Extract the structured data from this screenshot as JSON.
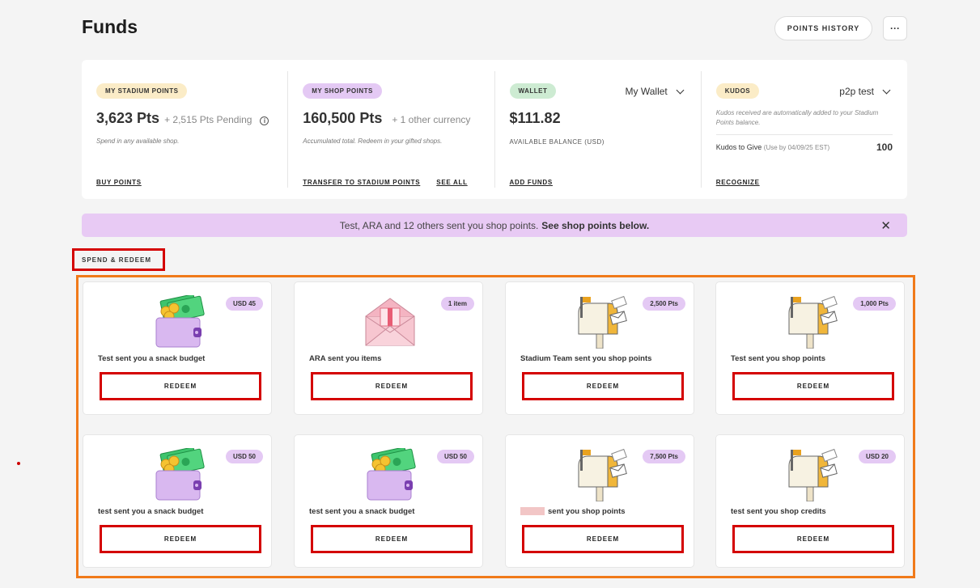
{
  "header": {
    "title": "Funds",
    "points_history_label": "POINTS HISTORY",
    "more_label": "···"
  },
  "funds": {
    "stadium": {
      "chip": "MY STADIUM POINTS",
      "value": "3,623 Pts",
      "pending": "+ 2,515 Pts Pending",
      "desc": "Spend in any available shop.",
      "link": "BUY POINTS"
    },
    "shop": {
      "chip": "MY SHOP POINTS",
      "value": "160,500 Pts",
      "sub": "+ 1 other currency",
      "desc": "Accumulated total. Redeem in your gifted shops.",
      "link1": "TRANSFER TO STADIUM POINTS",
      "link2": "SEE ALL"
    },
    "wallet": {
      "chip": "WALLET",
      "selector": "My Wallet",
      "value": "$111.82",
      "caption": "AVAILABLE BALANCE (USD)",
      "link": "ADD FUNDS"
    },
    "kudos": {
      "chip": "KUDOS",
      "selector": "p2p test",
      "note": "Kudos received are automatically added to your Stadium Points balance.",
      "give_label": "Kudos to Give",
      "give_note": "(Use by 04/09/25 EST)",
      "give_value": "100",
      "link": "RECOGNIZE"
    }
  },
  "banner": {
    "text": "Test, ARA and 12 others sent you shop points.",
    "bold": "See shop points below.",
    "close": "✕"
  },
  "section": {
    "label": "SPEND & REDEEM"
  },
  "cards": [
    {
      "badge": "USD 45",
      "title": "Test sent you a snack budget",
      "button": "REDEEM",
      "icon": "wallet-cash-icon"
    },
    {
      "badge": "1 item",
      "title": "ARA sent you items",
      "button": "REDEEM",
      "icon": "gift-envelope-icon"
    },
    {
      "badge": "2,500 Pts",
      "title": "Stadium Team sent you shop points",
      "button": "REDEEM",
      "icon": "mailbox-icon"
    },
    {
      "badge": "1,000 Pts",
      "title": "Test sent you shop points",
      "button": "REDEEM",
      "icon": "mailbox-icon"
    },
    {
      "badge": "USD 50",
      "title": "test sent you a snack budget",
      "button": "REDEEM",
      "icon": "wallet-cash-icon"
    },
    {
      "badge": "USD 50",
      "title": "test sent you a snack budget",
      "button": "REDEEM",
      "icon": "wallet-cash-icon"
    },
    {
      "badge": "7,500 Pts",
      "title": "sent you shop points",
      "button": "REDEEM",
      "icon": "mailbox-icon"
    },
    {
      "badge": "USD 20",
      "title": "test sent you shop credits",
      "button": "REDEEM",
      "icon": "mailbox-icon"
    }
  ]
}
